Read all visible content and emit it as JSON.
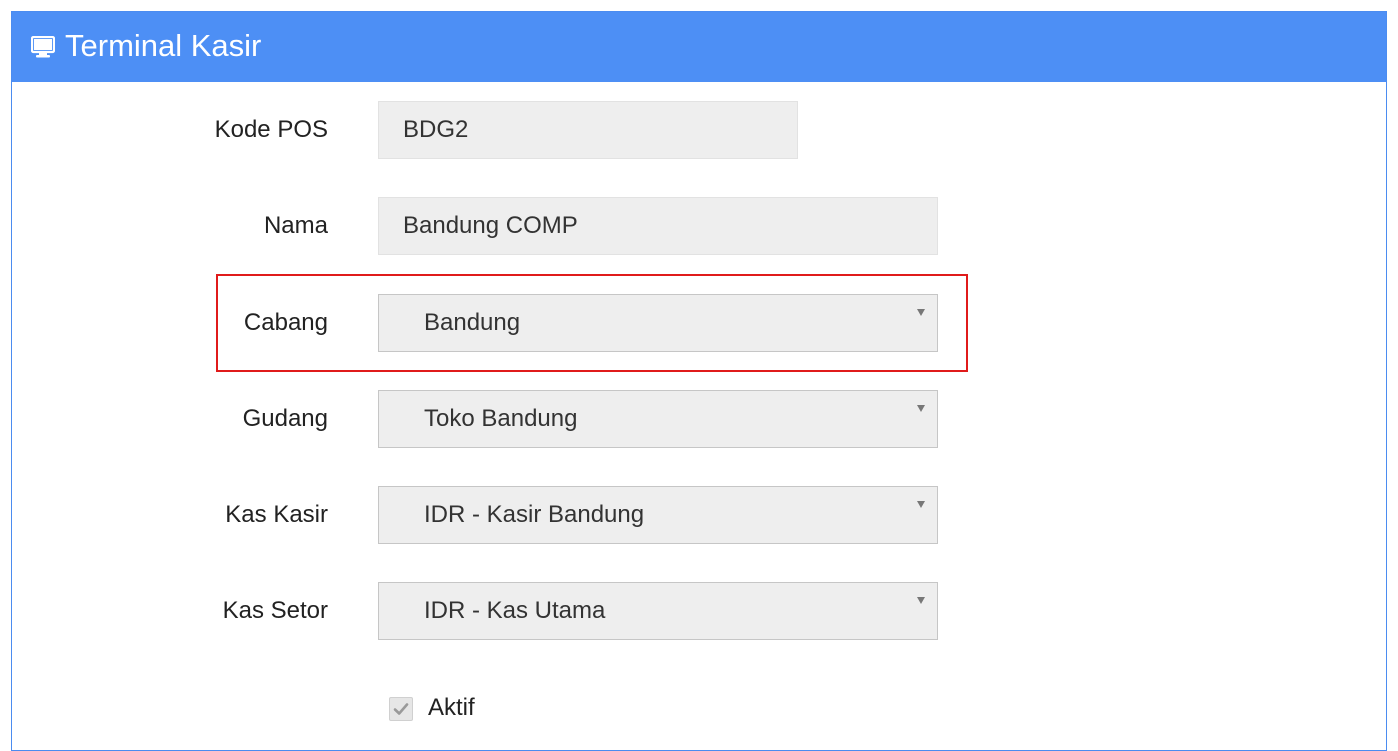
{
  "header": {
    "title": "Terminal Kasir",
    "icon": "monitor-icon",
    "color": "#4d8ff5"
  },
  "form": {
    "kode_pos": {
      "label": "Kode POS",
      "value": "BDG2"
    },
    "nama": {
      "label": "Nama",
      "value": "Bandung COMP"
    },
    "cabang": {
      "label": "Cabang",
      "value": "Bandung"
    },
    "gudang": {
      "label": "Gudang",
      "value": "Toko Bandung"
    },
    "kas_kasir": {
      "label": "Kas Kasir",
      "value": "IDR - Kasir Bandung"
    },
    "kas_setor": {
      "label": "Kas Setor",
      "value": "IDR - Kas Utama"
    },
    "aktif": {
      "label": "Aktif",
      "checked": true
    }
  },
  "highlight_color": "#e01b1b"
}
